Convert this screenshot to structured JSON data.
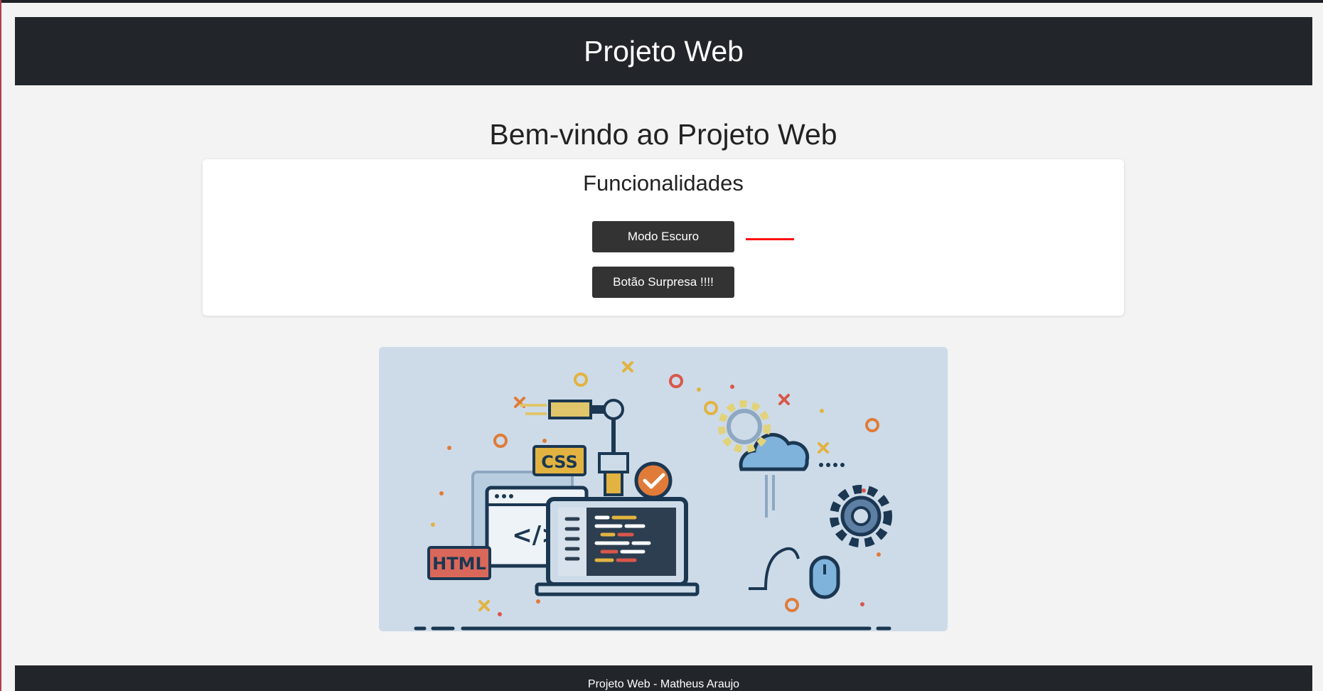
{
  "header": {
    "title": "Projeto Web"
  },
  "main": {
    "welcome": "Bem-vindo ao Projeto Web",
    "card": {
      "title": "Funcionalidades",
      "dark_mode_button": "Modo Escuro",
      "surprise_button": "Botão Surpresa !!!!"
    }
  },
  "illustration": {
    "css_label": "CSS",
    "html_label": "HTML",
    "code_label": "</>",
    "colors": {
      "background": "#cddbe8",
      "navy": "#1b3752",
      "yellow": "#e2b340",
      "orange": "#e07b39",
      "red": "#d9574b",
      "blue": "#7fb3dc"
    }
  },
  "footer": {
    "text": "Projeto Web - Matheus Araujo"
  },
  "colors": {
    "header_bg": "#22262b",
    "page_bg": "#f3f3f3",
    "button_bg": "#333333",
    "accent_line": "#ff1010"
  }
}
